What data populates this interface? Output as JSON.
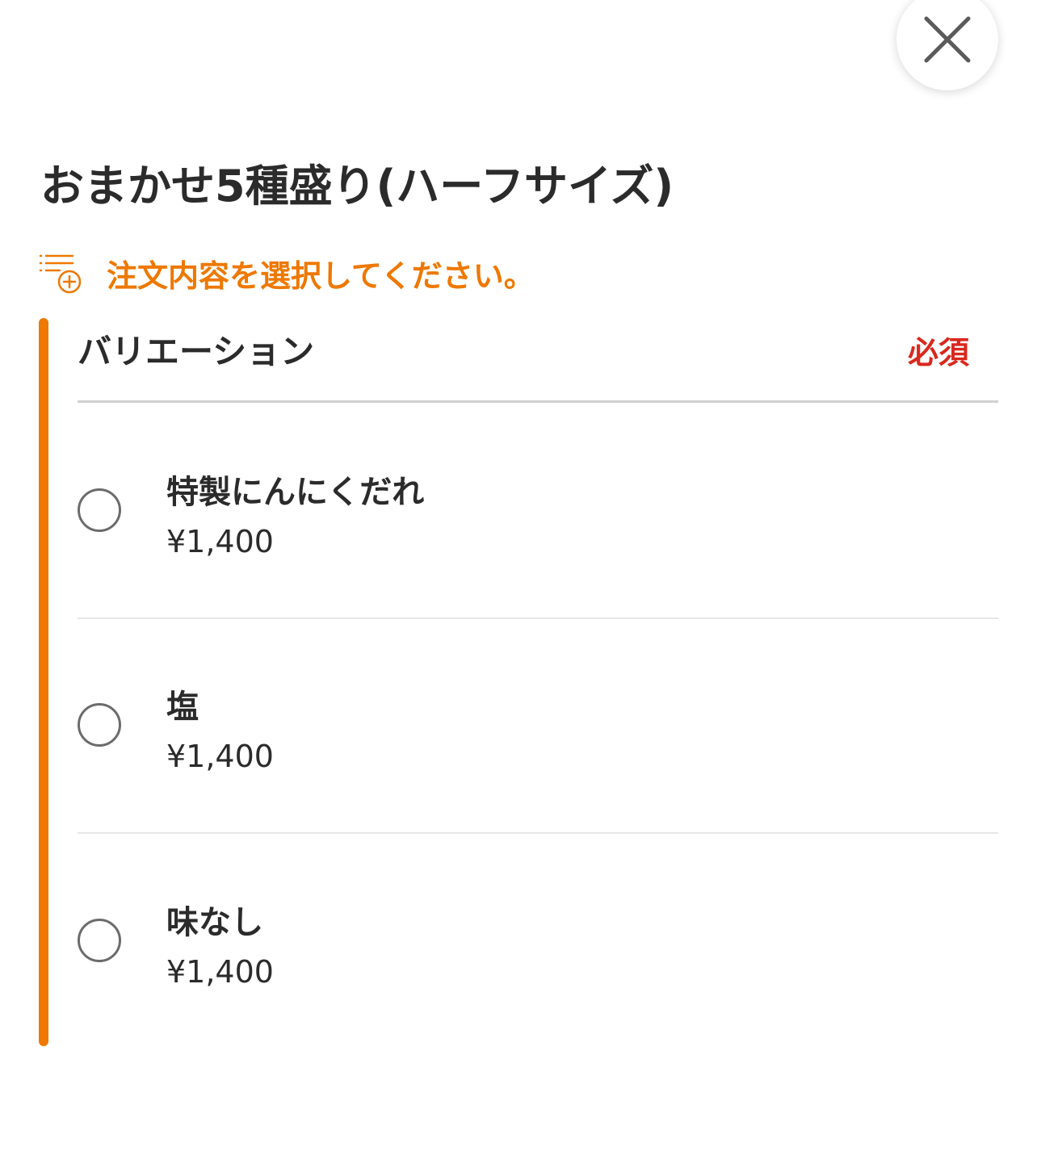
{
  "header": {
    "close_icon": "close-icon"
  },
  "item": {
    "title": "おまかせ5種盛り(ハーフサイズ)"
  },
  "instruction": {
    "icon": "list-add-icon",
    "text": "注文内容を選択してください。",
    "color": "#ee7800"
  },
  "variation": {
    "title": "バリエーション",
    "required_label": "必須",
    "required_color": "#d9281e",
    "options": [
      {
        "name": "特製にんにくだれ",
        "price": "¥1,400",
        "selected": false
      },
      {
        "name": "塩",
        "price": "¥1,400",
        "selected": false
      },
      {
        "name": "味なし",
        "price": "¥1,400",
        "selected": false
      }
    ]
  }
}
